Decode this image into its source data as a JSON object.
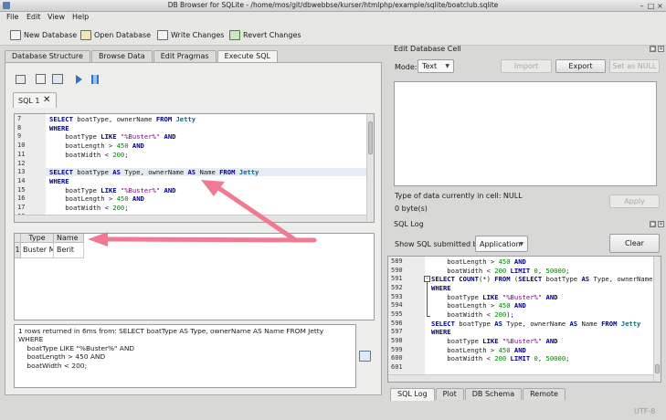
{
  "window": {
    "title": "DB Browser for SQLite - /home/mos/git/dbwebbse/kurser/htmlphp/example/sqlite/boatclub.sqlite"
  },
  "menu": [
    "File",
    "Edit",
    "View",
    "Help"
  ],
  "toolbar": {
    "new_database": "New Database",
    "open_database": "Open Database",
    "write_changes": "Write Changes",
    "revert_changes": "Revert Changes"
  },
  "main_tabs": [
    "Database Structure",
    "Browse Data",
    "Edit Pragmas",
    "Execute SQL"
  ],
  "sql_tab": {
    "label": "SQL 1"
  },
  "editor": {
    "lines": [
      {
        "num": "7",
        "tokens": [
          [
            "kw",
            "SELECT"
          ],
          [
            "id",
            " boatType, ownerName "
          ],
          [
            "kw",
            "FROM"
          ],
          [
            "tbl",
            " Jetty"
          ]
        ]
      },
      {
        "num": "8",
        "tokens": [
          [
            "kw",
            "WHERE"
          ]
        ]
      },
      {
        "num": "9",
        "tokens": [
          [
            "id",
            "    boatType "
          ],
          [
            "kw",
            "LIKE"
          ],
          [
            "str",
            " \"%Buster%\""
          ],
          [
            "kw",
            " AND"
          ]
        ]
      },
      {
        "num": "10",
        "tokens": [
          [
            "id",
            "    boatLength > "
          ],
          [
            "num",
            "450"
          ],
          [
            "kw",
            " AND"
          ]
        ]
      },
      {
        "num": "11",
        "tokens": [
          [
            "id",
            "    boatWidth < "
          ],
          [
            "num",
            "200"
          ],
          [
            "id",
            ";"
          ]
        ]
      },
      {
        "num": "12",
        "tokens": []
      },
      {
        "num": "13",
        "tokens": [
          [
            "kw",
            "SELECT"
          ],
          [
            "id",
            " boatType "
          ],
          [
            "kw",
            "AS"
          ],
          [
            "id",
            " Type, ownerName "
          ],
          [
            "kw",
            "AS"
          ],
          [
            "id",
            " Name "
          ],
          [
            "kw",
            "FROM"
          ],
          [
            "tbl",
            " Jetty"
          ]
        ]
      },
      {
        "num": "14",
        "tokens": [
          [
            "kw",
            "WHERE"
          ]
        ]
      },
      {
        "num": "15",
        "tokens": [
          [
            "id",
            "    boatType "
          ],
          [
            "kw",
            "LIKE"
          ],
          [
            "str",
            " \"%Buster%\""
          ],
          [
            "kw",
            " AND"
          ]
        ]
      },
      {
        "num": "16",
        "tokens": [
          [
            "id",
            "    boatLength > "
          ],
          [
            "num",
            "450"
          ],
          [
            "kw",
            " AND"
          ]
        ]
      },
      {
        "num": "17",
        "tokens": [
          [
            "id",
            "    boatWidth < "
          ],
          [
            "num",
            "200"
          ],
          [
            "id",
            ";"
          ]
        ]
      },
      {
        "num": "18",
        "tokens": []
      }
    ]
  },
  "results": {
    "headers": [
      "Type",
      "Name"
    ],
    "rows": [
      {
        "row": "1",
        "cells": [
          "Buster M",
          "Berit"
        ]
      }
    ]
  },
  "message": "1 rows returned in 6ms from: SELECT boatType AS Type, ownerName AS Name FROM Jetty\nWHERE\n    boatType LIKE \"%Buster%\" AND\n    boatLength > 450 AND\n    boatWidth < 200;",
  "edit_cell": {
    "title": "Edit Database Cell",
    "mode_label": "Mode:",
    "mode_value": "Text",
    "import": "Import",
    "export": "Export",
    "set_null": "Set as NULL",
    "type_info": "Type of data currently in cell: NULL",
    "size_info": "0 byte(s)",
    "apply": "Apply"
  },
  "sql_log": {
    "title": "SQL Log",
    "show_label": "Show SQL submitted by",
    "source": "Application",
    "clear": "Clear",
    "lines": [
      {
        "num": "589",
        "tokens": [
          [
            "id",
            "    boatLength > "
          ],
          [
            "num",
            "450"
          ],
          [
            "kw",
            " AND"
          ]
        ]
      },
      {
        "num": "590",
        "tokens": [
          [
            "id",
            "    boatWidth < "
          ],
          [
            "num",
            "200"
          ],
          [
            "kw",
            " LIMIT"
          ],
          [
            "num",
            " 0"
          ],
          [
            "id",
            ", "
          ],
          [
            "num",
            "50000"
          ],
          [
            "id",
            ";"
          ]
        ]
      },
      {
        "num": "591",
        "tokens": [
          [
            "kw",
            "SELECT"
          ],
          [
            "kw",
            " COUNT"
          ],
          [
            "id",
            "(*) "
          ],
          [
            "kw",
            "FROM"
          ],
          [
            "id",
            " ("
          ],
          [
            "kw",
            "SELECT"
          ],
          [
            "id",
            " boatType "
          ],
          [
            "kw",
            "AS"
          ],
          [
            "id",
            " Type, ownerName "
          ],
          [
            "kw",
            "A"
          ]
        ]
      },
      {
        "num": "592",
        "tokens": [
          [
            "kw",
            "WHERE"
          ]
        ]
      },
      {
        "num": "593",
        "tokens": [
          [
            "id",
            "    boatType "
          ],
          [
            "kw",
            "LIKE"
          ],
          [
            "str",
            " \"%Buster%\""
          ],
          [
            "kw",
            " AND"
          ]
        ]
      },
      {
        "num": "594",
        "tokens": [
          [
            "id",
            "    boatLength > "
          ],
          [
            "num",
            "450"
          ],
          [
            "kw",
            " AND"
          ]
        ]
      },
      {
        "num": "595",
        "tokens": [
          [
            "id",
            "    boatWidth < "
          ],
          [
            "num",
            "200"
          ],
          [
            "id",
            ");"
          ]
        ]
      },
      {
        "num": "596",
        "tokens": [
          [
            "kw",
            "SELECT"
          ],
          [
            "id",
            " boatType "
          ],
          [
            "kw",
            "AS"
          ],
          [
            "id",
            " Type, ownerName "
          ],
          [
            "kw",
            "AS"
          ],
          [
            "id",
            " Name "
          ],
          [
            "kw",
            "FROM"
          ],
          [
            "tbl",
            " Jetty"
          ]
        ]
      },
      {
        "num": "597",
        "tokens": [
          [
            "kw",
            "WHERE"
          ]
        ]
      },
      {
        "num": "598",
        "tokens": [
          [
            "id",
            "    boatType "
          ],
          [
            "kw",
            "LIKE"
          ],
          [
            "str",
            " \"%Buster%\""
          ],
          [
            "kw",
            " AND"
          ]
        ]
      },
      {
        "num": "599",
        "tokens": [
          [
            "id",
            "    boatLength > "
          ],
          [
            "num",
            "450"
          ],
          [
            "kw",
            " AND"
          ]
        ]
      },
      {
        "num": "600",
        "tokens": [
          [
            "id",
            "    boatWidth < "
          ],
          [
            "num",
            "200"
          ],
          [
            "kw",
            " LIMIT"
          ],
          [
            "num",
            " 0"
          ],
          [
            "id",
            ", "
          ],
          [
            "num",
            "50000"
          ],
          [
            "id",
            ";"
          ]
        ]
      },
      {
        "num": "601",
        "tokens": []
      }
    ]
  },
  "bottom_tabs": [
    "SQL Log",
    "Plot",
    "DB Schema",
    "Remote"
  ],
  "status": {
    "encoding": "UTF-8"
  },
  "colors": {
    "annotation_arrow": "#f07a93"
  }
}
